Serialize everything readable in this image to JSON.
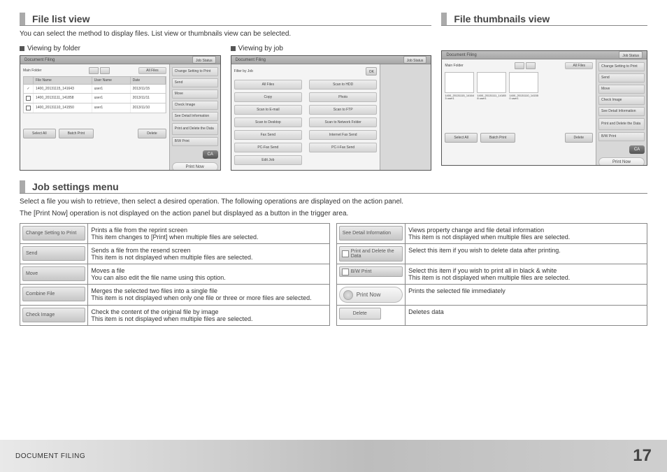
{
  "headings": {
    "file_list": "File list view",
    "file_thumb": "File thumbnails view",
    "job_settings": "Job settings menu"
  },
  "intro_list": "You can select the method to display files. List view or thumbnails view can be selected.",
  "view_folder": "Viewing by folder",
  "view_job": "Viewing by job",
  "intro_job1": "Select a file you wish to retrieve, then select a desired operation. The following operations are displayed on the action panel.",
  "intro_job2": "The [Print Now] operation is not displayed on the action panel but displayed as a button in the trigger area.",
  "panel": {
    "title": "Document Filing",
    "job_status": "Job Status",
    "main_folder": "Main Folder",
    "all_files": "All Files",
    "filter_by": "Filter by Job",
    "ok": "OK",
    "cols": {
      "file": "File Name",
      "user": "User Name",
      "date": "Date"
    },
    "rows": [
      {
        "f": "1400_20131115_141643",
        "u": "user1",
        "d": "2013/11/15"
      },
      {
        "f": "1400_20131111_141858",
        "u": "user1",
        "d": "2013/11/11"
      },
      {
        "f": "1400_20131110_141550",
        "u": "user1",
        "d": "2013/11/10"
      }
    ],
    "thumbs": [
      {
        "cap": "1400_20131115_141643 user1"
      },
      {
        "cap": "1400_20131111_141858 user1"
      },
      {
        "cap": "1400_20131110_141550 user1"
      }
    ],
    "jobs": [
      "All Files",
      "Scan to HDD",
      "Copy",
      "Photo",
      "Scan to E-mail",
      "Scan to FTP",
      "Scan to Desktop",
      "Scan to Network Folder",
      "Fax Send",
      "Internet Fax Send",
      "PC-Fax Send",
      "PC-I-Fax Send",
      "Edit Job",
      ""
    ],
    "actions": {
      "change": "Change Setting to Print",
      "send": "Send",
      "move": "Move",
      "check": "Check Image",
      "detail": "See Detail Information",
      "pad": "Print and Delete the Data",
      "bw": "B/W Print",
      "ca": "CA",
      "print_now": "Print Now"
    },
    "bottom": {
      "select_all": "Select All",
      "batch": "Batch Print",
      "delete": "Delete"
    }
  },
  "menu": {
    "rows": [
      {
        "l_label": "Change Setting to Print",
        "l_type": "btn",
        "l_desc": "Prints a file from the reprint screen\nThis item changes to [Print] when multiple files are selected.",
        "r_label": "See Detail Information",
        "r_type": "btn",
        "r_desc": "Views property change and file detail information\nThis item is not displayed when multiple files are selected."
      },
      {
        "l_label": "Send",
        "l_type": "btn",
        "l_desc": "Sends a file from the resend screen\nThis item is not displayed when multiple files are selected.",
        "r_label": "Print and Delete the Data",
        "r_type": "chk",
        "r_desc": "Select this item if you wish to delete data after printing."
      },
      {
        "l_label": "Move",
        "l_type": "btn",
        "l_desc": "Moves a file\nYou can also edit the file name using this option.",
        "r_label": "B/W Print",
        "r_type": "chk",
        "r_desc": "Select this item if you wish to print all in black & white\nThis item is not displayed when multiple files are selected."
      },
      {
        "l_label": "Combine File",
        "l_type": "btn",
        "l_desc": "Merges the selected two files into a single file\nThis item is not displayed when only one file or three or more files are selected.",
        "r_label": "Print Now",
        "r_type": "pn",
        "r_desc": "Prints the selected file immediately"
      },
      {
        "l_label": "Check Image",
        "l_type": "btn",
        "l_desc": "Check the content of the original file by image\nThis item is not displayed when multiple files are selected.",
        "r_label": "Delete",
        "r_type": "del",
        "r_desc": "Deletes data"
      }
    ]
  },
  "footer": {
    "section": "Document Filing",
    "page": "17"
  }
}
